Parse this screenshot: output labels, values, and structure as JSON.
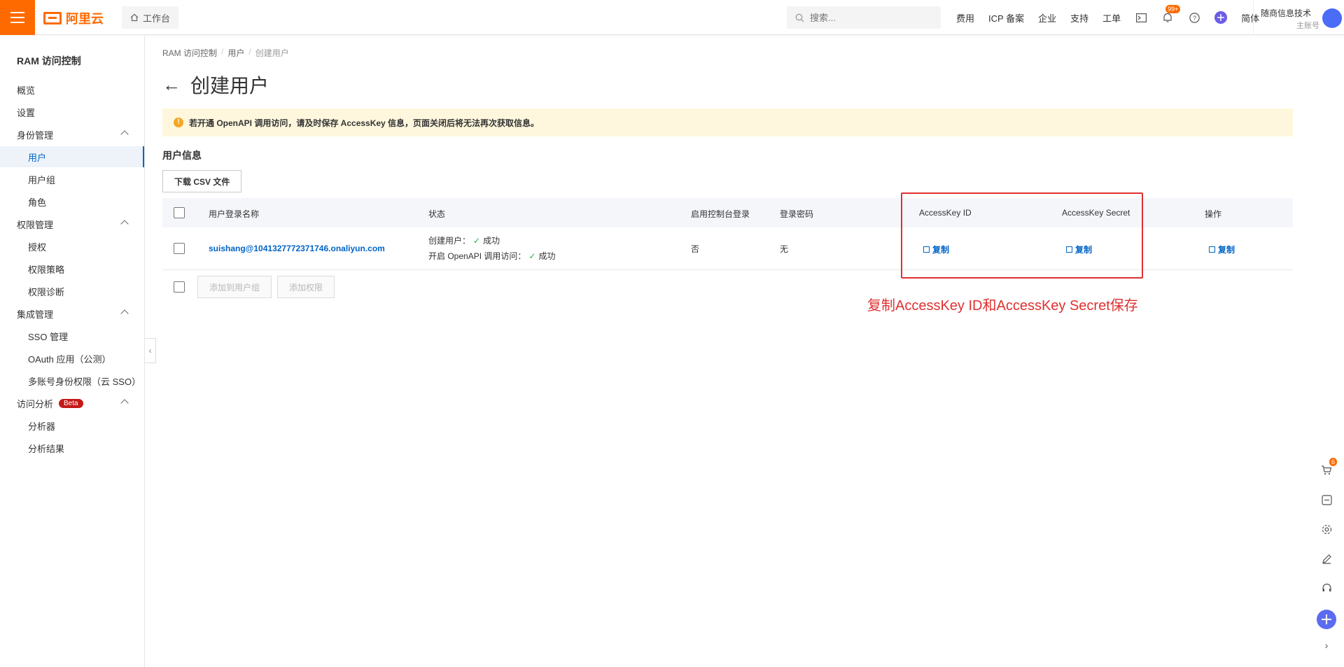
{
  "topbar": {
    "brand": "阿里云",
    "workbench": "工作台",
    "search_placeholder": "搜索...",
    "nav": [
      "费用",
      "ICP 备案",
      "企业",
      "支持",
      "工单"
    ],
    "notif_badge": "99+",
    "lang": "简体",
    "account_name": "随商信息技术",
    "account_role": "主账号"
  },
  "sidebar": {
    "title": "RAM 访问控制",
    "items": [
      {
        "label": "概览"
      },
      {
        "label": "设置"
      },
      {
        "label": "身份管理"
      },
      {
        "label": "用户"
      },
      {
        "label": "用户组"
      },
      {
        "label": "角色"
      },
      {
        "label": "权限管理"
      },
      {
        "label": "授权"
      },
      {
        "label": "权限策略"
      },
      {
        "label": "权限诊断"
      },
      {
        "label": "集成管理"
      },
      {
        "label": "SSO 管理"
      },
      {
        "label": "OAuth 应用（公测）"
      },
      {
        "label": "多账号身份权限（云 SSO）"
      },
      {
        "label": "访问分析"
      },
      {
        "label": "分析器"
      },
      {
        "label": "分析结果"
      }
    ],
    "beta": "Beta"
  },
  "breadcrumb": [
    "RAM 访问控制",
    "用户",
    "创建用户"
  ],
  "page_title": "创建用户",
  "alert": "若开通 OpenAPI 调用访问，请及时保存 AccessKey 信息，页面关闭后将无法再次获取信息。",
  "section_title": "用户信息",
  "download_btn": "下载 CSV 文件",
  "table": {
    "headers": [
      "用户登录名称",
      "状态",
      "启用控制台登录",
      "登录密码",
      "AccessKey ID",
      "AccessKey Secret",
      "操作"
    ],
    "row": {
      "login_name": "suishang@1041327772371746.onaliyun.com",
      "status_create_label": "创建用户：",
      "status_create_value": "成功",
      "status_api_label": "开启 OpenAPI 调用访问：",
      "status_api_value": "成功",
      "console_login": "否",
      "password": "无",
      "copy": "复制"
    }
  },
  "footer_buttons": [
    "添加到用户组",
    "添加权限"
  ],
  "annotation": "复制AccessKey ID和AccessKey Secret保存",
  "rail": {
    "cart_badge": "6"
  },
  "colors": {
    "brand": "#ff6a00",
    "link": "#0064c8",
    "annotation": "#e03030",
    "alert_bg": "#fff7dd"
  }
}
